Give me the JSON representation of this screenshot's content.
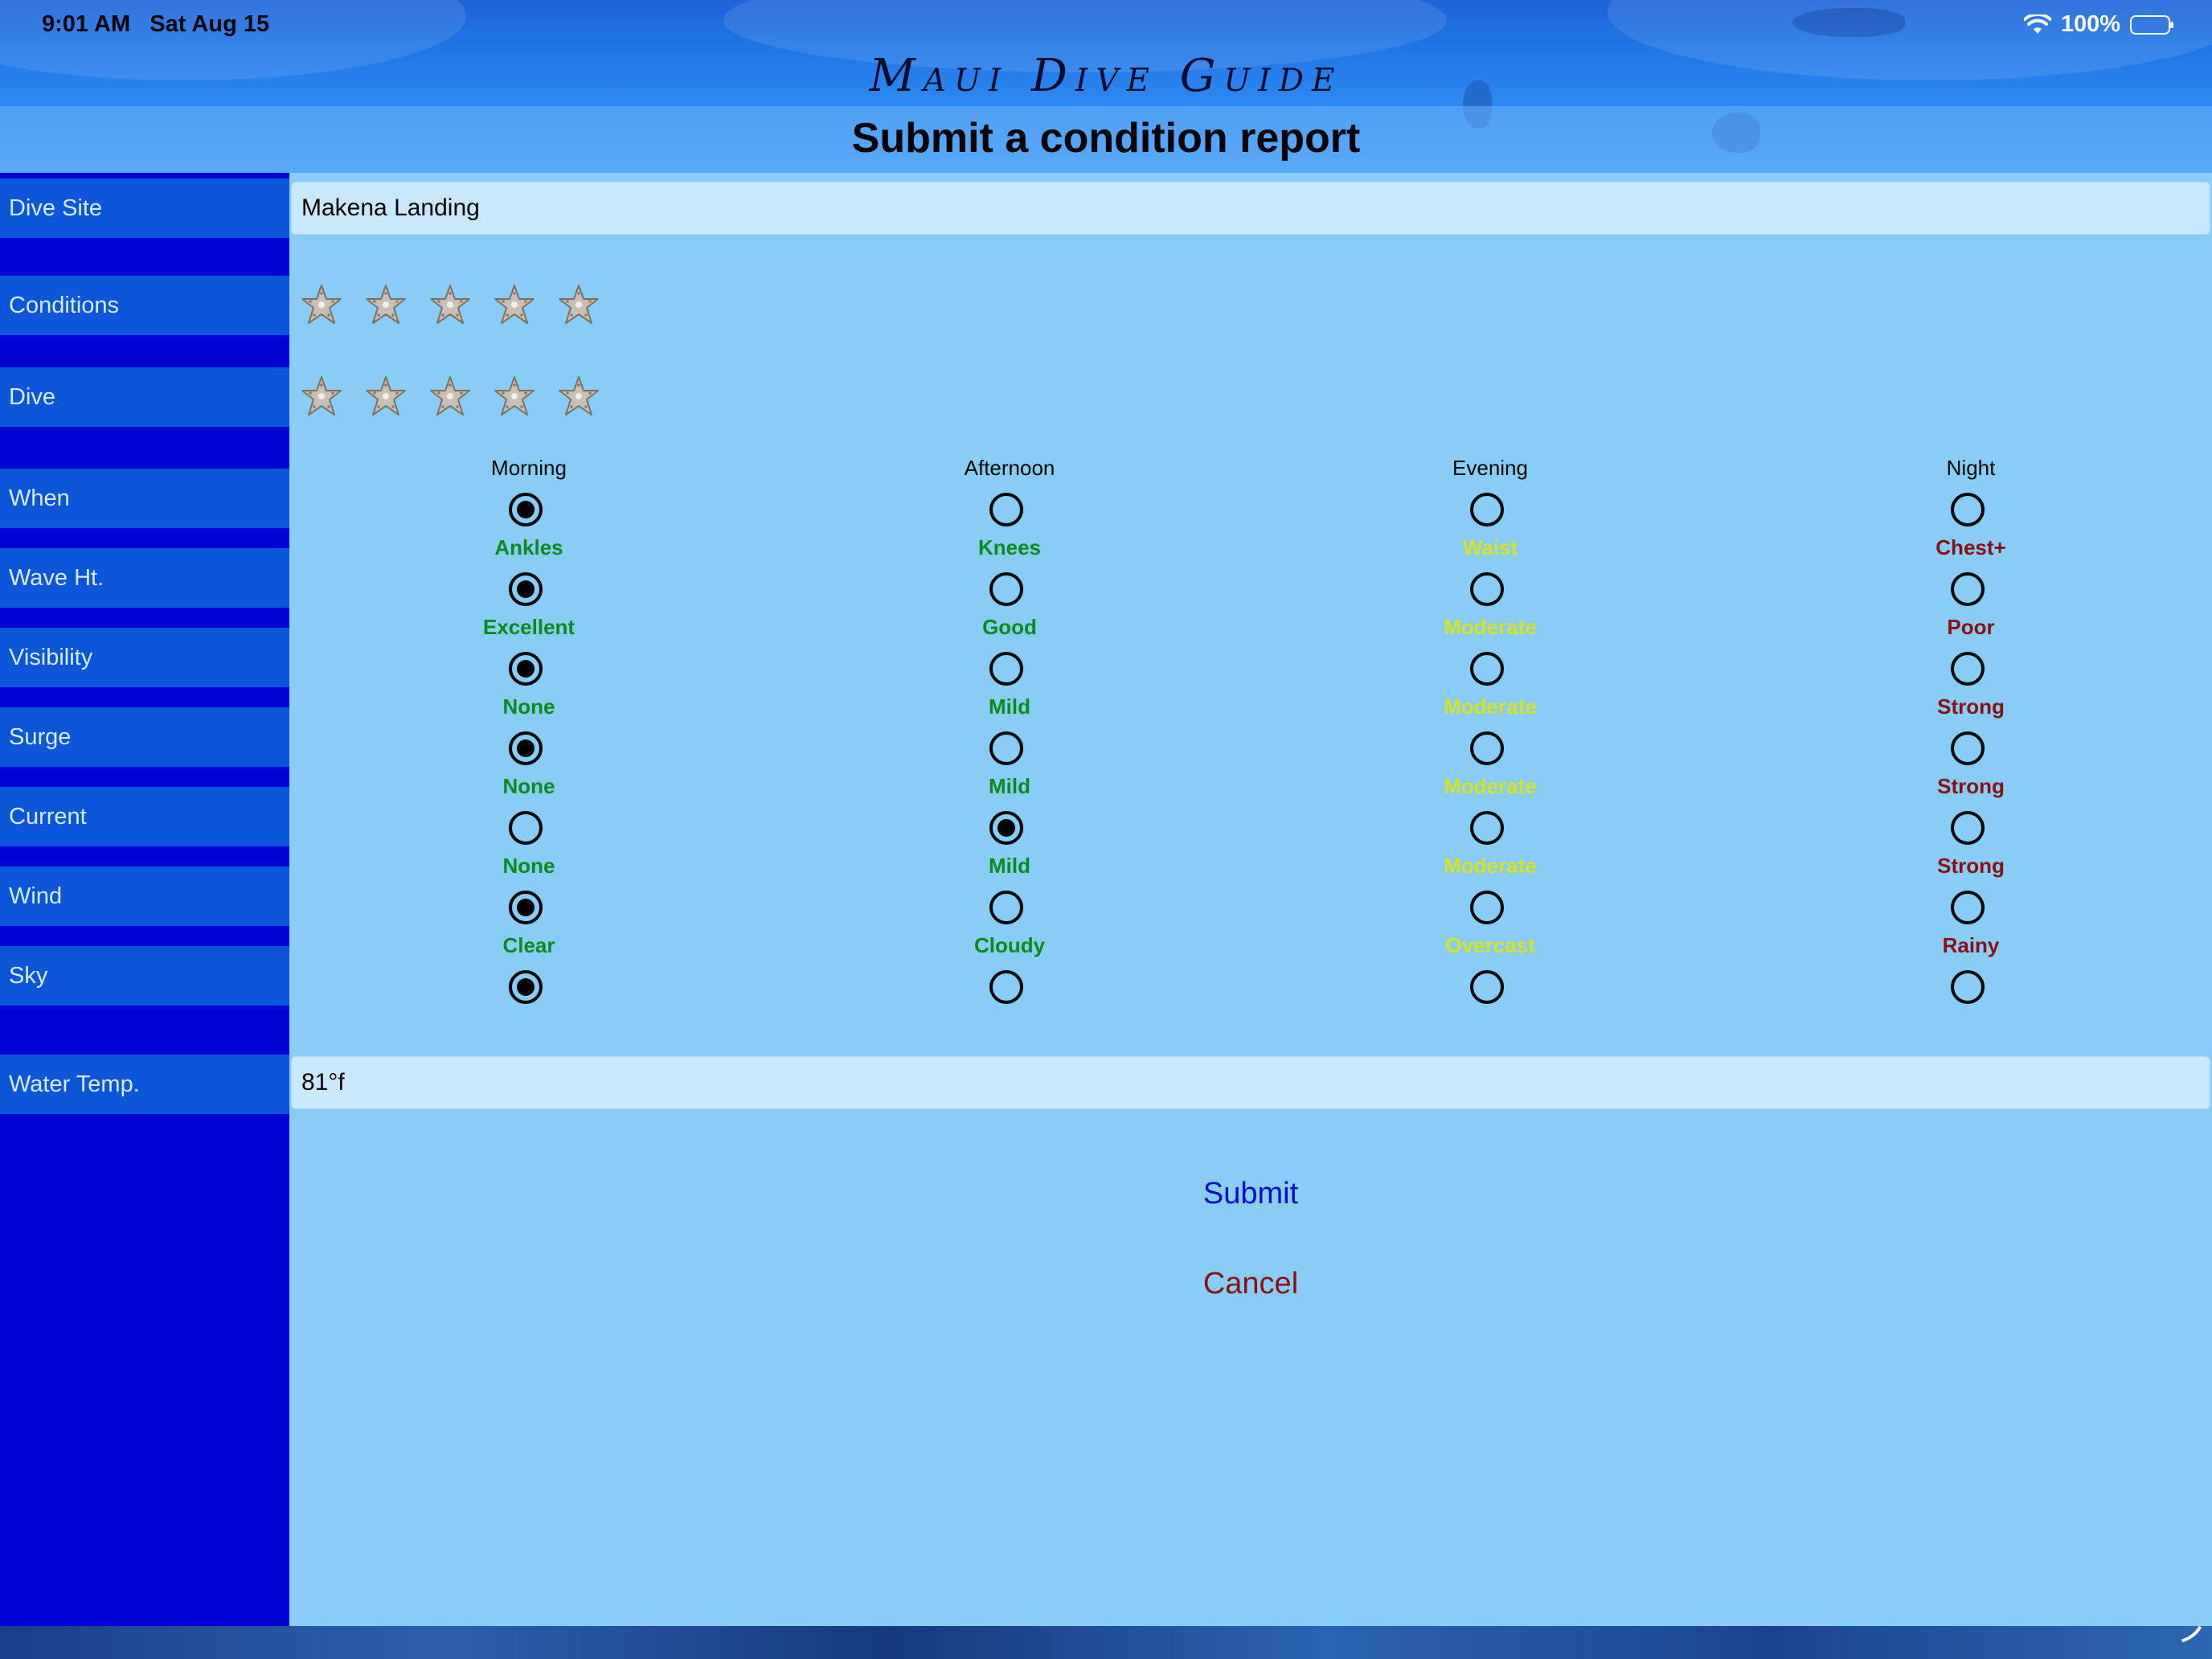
{
  "status_bar": {
    "time": "9:01 AM",
    "date": "Sat Aug 15",
    "battery": "100%"
  },
  "header": {
    "app_title": "Maui Dive Guide",
    "page_title": "Submit a condition report"
  },
  "fields": {
    "dive_site_label": "Dive Site",
    "dive_site_value": "Makena Landing",
    "conditions_label": "Conditions",
    "dive_label": "Dive",
    "water_temp_label": "Water Temp.",
    "water_temp_value": "81°f"
  },
  "ratings": {
    "conditions": 0,
    "dive": 0,
    "max": 5
  },
  "rows": [
    {
      "label": "When",
      "options": [
        "Morning",
        "Afternoon",
        "Evening",
        "Night"
      ],
      "selected": 0,
      "colors": [
        "#000000",
        "#000000",
        "#000000",
        "#000000"
      ]
    },
    {
      "label": "Wave Ht.",
      "options": [
        "Ankles",
        "Knees",
        "Waist",
        "Chest+"
      ],
      "selected": 0,
      "colors": [
        "#0e8a1c",
        "#0e8a1c",
        "#d8e22a",
        "#8b0f12"
      ]
    },
    {
      "label": "Visibility",
      "options": [
        "Excellent",
        "Good",
        "Moderate",
        "Poor"
      ],
      "selected": 0,
      "colors": [
        "#0e8a1c",
        "#0e8a1c",
        "#d8e22a",
        "#8b0f12"
      ]
    },
    {
      "label": "Surge",
      "options": [
        "None",
        "Mild",
        "Moderate",
        "Strong"
      ],
      "selected": 0,
      "colors": [
        "#0e8a1c",
        "#0e8a1c",
        "#d8e22a",
        "#8b0f12"
      ]
    },
    {
      "label": "Current",
      "options": [
        "None",
        "Mild",
        "Moderate",
        "Strong"
      ],
      "selected": 1,
      "colors": [
        "#0e8a1c",
        "#0e8a1c",
        "#d8e22a",
        "#8b0f12"
      ]
    },
    {
      "label": "Wind",
      "options": [
        "None",
        "Mild",
        "Moderate",
        "Strong"
      ],
      "selected": 0,
      "colors": [
        "#0e8a1c",
        "#0e8a1c",
        "#d8e22a",
        "#8b0f12"
      ]
    },
    {
      "label": "Sky",
      "options": [
        "Clear",
        "Cloudy",
        "Overcast",
        "Rainy"
      ],
      "selected": 0,
      "colors": [
        "#0e8a1c",
        "#0e8a1c",
        "#d8e22a",
        "#8b0f12"
      ]
    }
  ],
  "actions": {
    "submit": "Submit",
    "cancel": "Cancel"
  },
  "colors": {
    "sidebar": "#0000d2",
    "label_bg": "#0a55d8",
    "content_bg": "#87cdf6",
    "field_bg": "#c9e8fc",
    "submit": "#0a0ac8",
    "cancel": "#8b0f12"
  }
}
